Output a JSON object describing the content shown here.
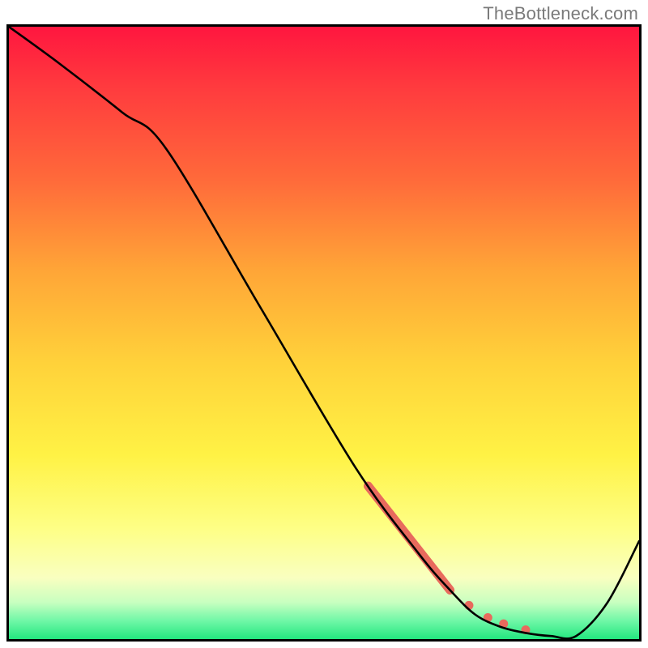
{
  "watermark": "TheBottleneck.com",
  "chart_data": {
    "type": "line",
    "title": "",
    "xlabel": "",
    "ylabel": "",
    "xlim": [
      0,
      100
    ],
    "ylim": [
      0,
      100
    ],
    "series": [
      {
        "name": "curve",
        "x": [
          0,
          8,
          18,
          25,
          40,
          55,
          65,
          70,
          74,
          78,
          82,
          86,
          90,
          95,
          100
        ],
        "y": [
          100,
          94,
          86,
          80,
          54,
          28,
          14,
          8,
          4,
          2,
          1,
          0.5,
          0.5,
          6,
          16
        ]
      }
    ],
    "highlight_segment": {
      "x": [
        57,
        70
      ],
      "y": [
        25,
        8
      ]
    },
    "dots": [
      {
        "x": 73,
        "y": 5.5
      },
      {
        "x": 76,
        "y": 3.5
      },
      {
        "x": 78.5,
        "y": 2.5
      },
      {
        "x": 82,
        "y": 1.5
      }
    ],
    "background_gradient": {
      "stops": [
        {
          "pos": 0,
          "color": "#ff163f"
        },
        {
          "pos": 10,
          "color": "#ff3b3e"
        },
        {
          "pos": 25,
          "color": "#ff6a3a"
        },
        {
          "pos": 40,
          "color": "#ffa637"
        },
        {
          "pos": 55,
          "color": "#ffd23a"
        },
        {
          "pos": 70,
          "color": "#fff245"
        },
        {
          "pos": 82,
          "color": "#feff86"
        },
        {
          "pos": 90,
          "color": "#f9ffc0"
        },
        {
          "pos": 94,
          "color": "#c8ffc0"
        },
        {
          "pos": 97,
          "color": "#70f7a7"
        },
        {
          "pos": 100,
          "color": "#23e77f"
        }
      ]
    }
  }
}
